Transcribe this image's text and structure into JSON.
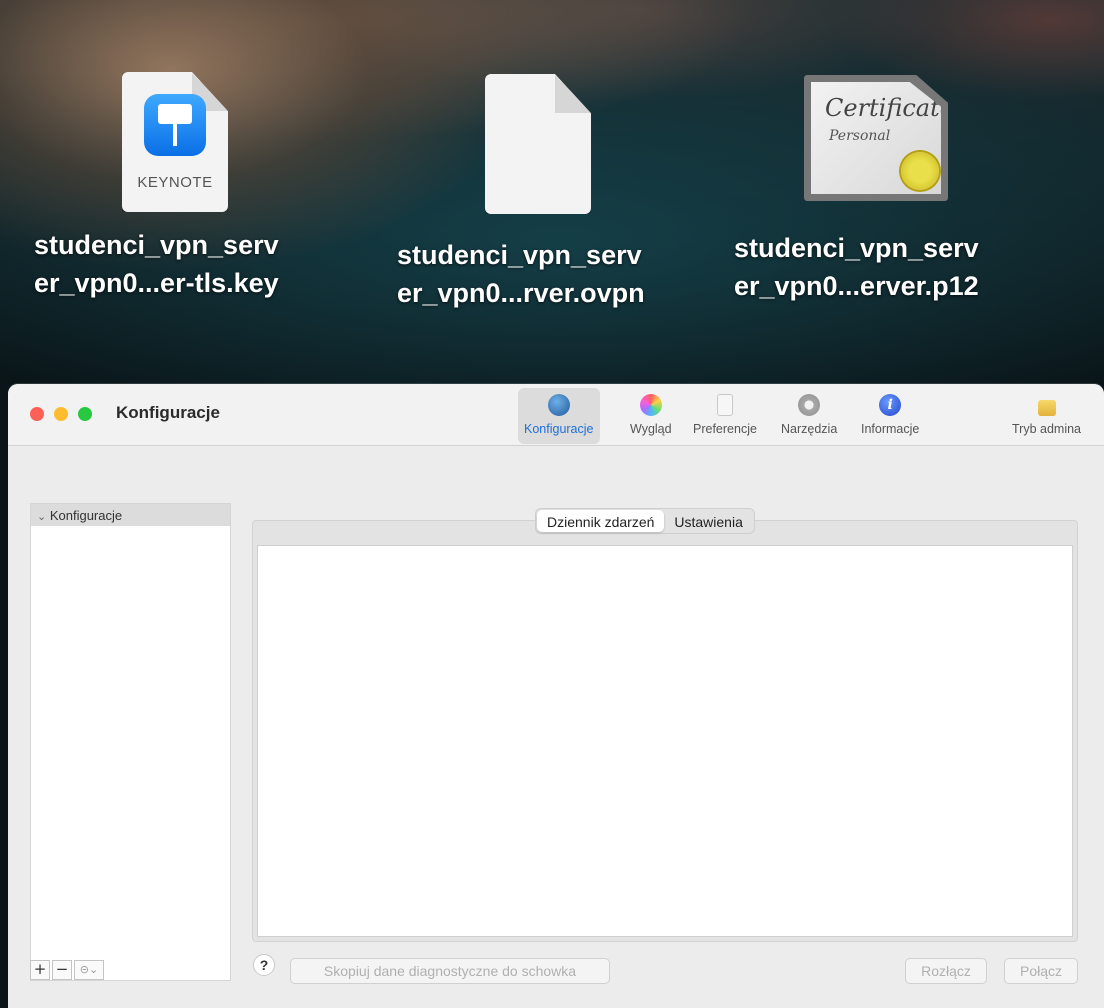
{
  "desktop": {
    "files": [
      {
        "name_line1": "studenci_vpn_serv",
        "name_line2": "er_vpn0...er-tls.key",
        "icon": "keynote-document-icon",
        "badge": "KEYNOTE"
      },
      {
        "name_line1": "studenci_vpn_serv",
        "name_line2": "er_vpn0...rver.ovpn",
        "icon": "blank-document-icon"
      },
      {
        "name_line1": "studenci_vpn_serv",
        "name_line2": "er_vpn0...erver.p12",
        "icon": "certificate-icon",
        "cert_title": "Certificate",
        "cert_sub": "Personal"
      }
    ]
  },
  "window": {
    "title": "Konfiguracje",
    "toolbar": [
      {
        "label": "Konfiguracje",
        "icon": "globe-icon",
        "color": "#2a6fb4",
        "active": true
      },
      {
        "label": "Wygląd",
        "icon": "color-wheel-icon",
        "color": "#e86bd0"
      },
      {
        "label": "Preferencje",
        "icon": "switch-icon",
        "color": "#bdbdbd"
      },
      {
        "label": "Narzędzia",
        "icon": "gear-icon",
        "color": "#9a9a9a"
      },
      {
        "label": "Informacje",
        "icon": "info-icon",
        "color": "#2f5fe0",
        "glyph": "i"
      },
      {
        "label": "Tryb admina",
        "icon": "lock-icon",
        "color": "#f0c74a"
      }
    ],
    "sidebar": {
      "header": "Konfiguracje",
      "chevron": "⌄",
      "tools": {
        "add": "+",
        "remove": "−",
        "menu": "⊝⌄"
      }
    },
    "tabs": [
      {
        "label": "Dziennik zdarzeń",
        "active": true
      },
      {
        "label": "Ustawienia",
        "active": false
      }
    ],
    "bottom": {
      "help": "?",
      "copy_button": "Skopiuj dane diagnostyczne do schowka",
      "disconnect_button": "Rozłącz",
      "connect_button": "Połącz"
    }
  }
}
